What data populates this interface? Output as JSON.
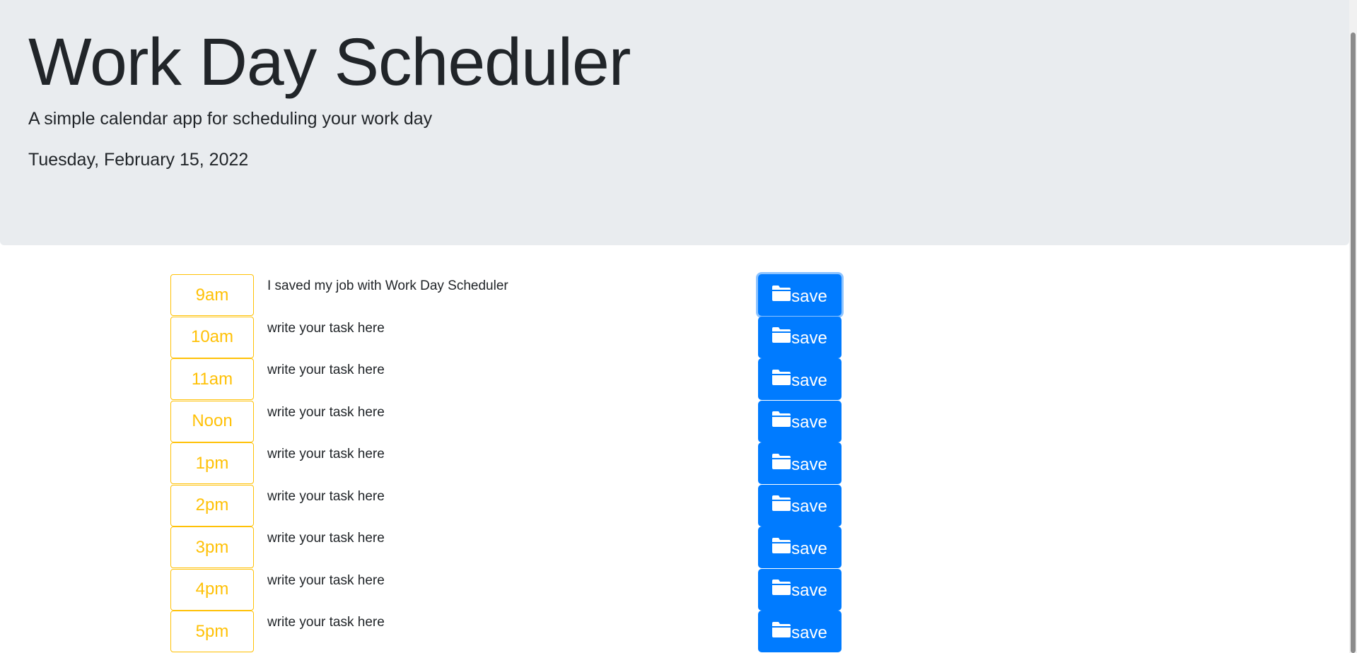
{
  "header": {
    "title": "Work Day Scheduler",
    "subtitle": "A simple calendar app for scheduling your work day",
    "date": "Tuesday, February 15, 2022"
  },
  "colors": {
    "jumbotron_bg": "#e9ecef",
    "hour_accent": "#ffc107",
    "save_button": "#007bff"
  },
  "rows": [
    {
      "hour": "9am",
      "task": "I saved my job with Work Day Scheduler",
      "save_label": "save",
      "save_icon": "folder-icon"
    },
    {
      "hour": "10am",
      "task": "write your task here",
      "save_label": "save",
      "save_icon": "folder-icon"
    },
    {
      "hour": "11am",
      "task": "write your task here",
      "save_label": "save",
      "save_icon": "folder-icon"
    },
    {
      "hour": "Noon",
      "task": "write your task here",
      "save_label": "save",
      "save_icon": "folder-icon"
    },
    {
      "hour": "1pm",
      "task": "write your task here",
      "save_label": "save",
      "save_icon": "folder-icon"
    },
    {
      "hour": "2pm",
      "task": "write your task here",
      "save_label": "save",
      "save_icon": "folder-icon"
    },
    {
      "hour": "3pm",
      "task": "write your task here",
      "save_label": "save",
      "save_icon": "folder-icon"
    },
    {
      "hour": "4pm",
      "task": "write your task here",
      "save_label": "save",
      "save_icon": "folder-icon"
    },
    {
      "hour": "5pm",
      "task": "write your task here",
      "save_label": "save",
      "save_icon": "folder-icon"
    }
  ]
}
